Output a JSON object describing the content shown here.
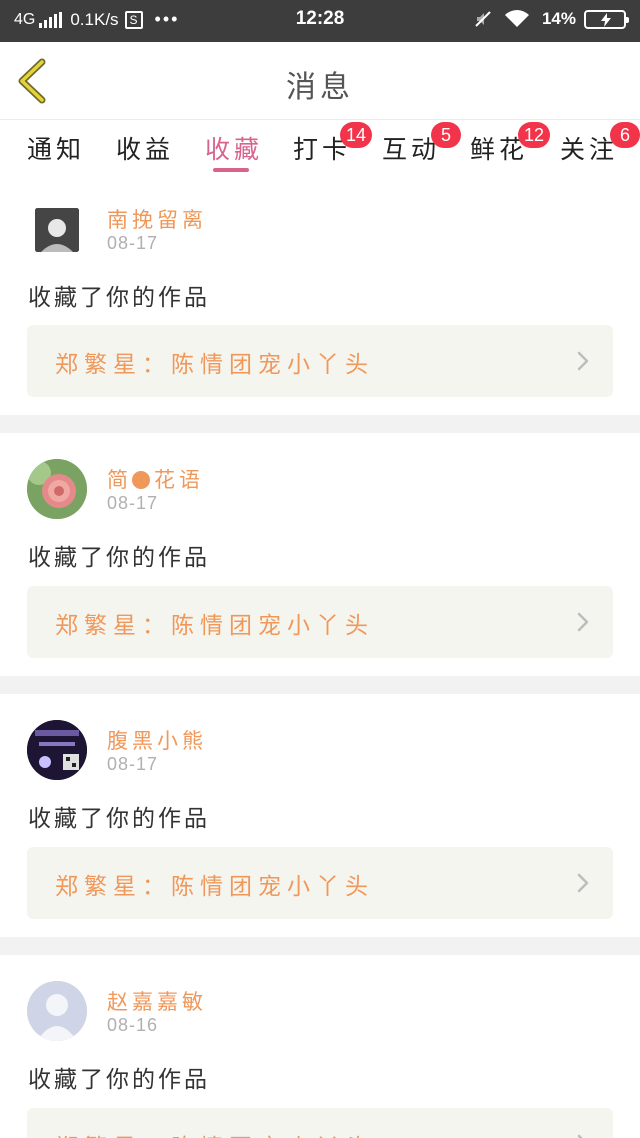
{
  "status_bar": {
    "network": "4G",
    "speed": "0.1K/s",
    "s_icon_label": "S",
    "dots": "•••",
    "time": "12:28",
    "battery": "14%",
    "icons": [
      "signal-icon",
      "s-app-icon",
      "mute-icon",
      "wifi-icon",
      "battery-icon"
    ]
  },
  "header": {
    "title": "消息",
    "back_icon": "chevron-left-icon"
  },
  "tabs": [
    {
      "label": "通知",
      "badge": ""
    },
    {
      "label": "收益",
      "badge": ""
    },
    {
      "label": "收藏",
      "badge": "",
      "active": true
    },
    {
      "label": "打卡",
      "badge": "14"
    },
    {
      "label": "互动",
      "badge": "5"
    },
    {
      "label": "鲜花",
      "badge": "12"
    },
    {
      "label": "关注",
      "badge": "6"
    }
  ],
  "colors": {
    "accent": "#d8648e",
    "name": "#f0985a",
    "badge": "#f2344b",
    "work_box": "#f5f5f0"
  },
  "feed": [
    {
      "name": "南挽留离",
      "date": "08-17",
      "action": "收藏了你的作品",
      "work": "郑繁星：陈情团宠小丫头"
    },
    {
      "name_before": "简",
      "name_after": "花语",
      "date": "08-17",
      "action": "收藏了你的作品",
      "work": "郑繁星：陈情团宠小丫头"
    },
    {
      "name": "腹黑小熊",
      "date": "08-17",
      "action": "收藏了你的作品",
      "work": "郑繁星：陈情团宠小丫头"
    },
    {
      "name": "赵嘉嘉敏",
      "date": "08-16",
      "action": "收藏了你的作品",
      "work": "郑繁星：陈情团宠小丫头"
    }
  ]
}
